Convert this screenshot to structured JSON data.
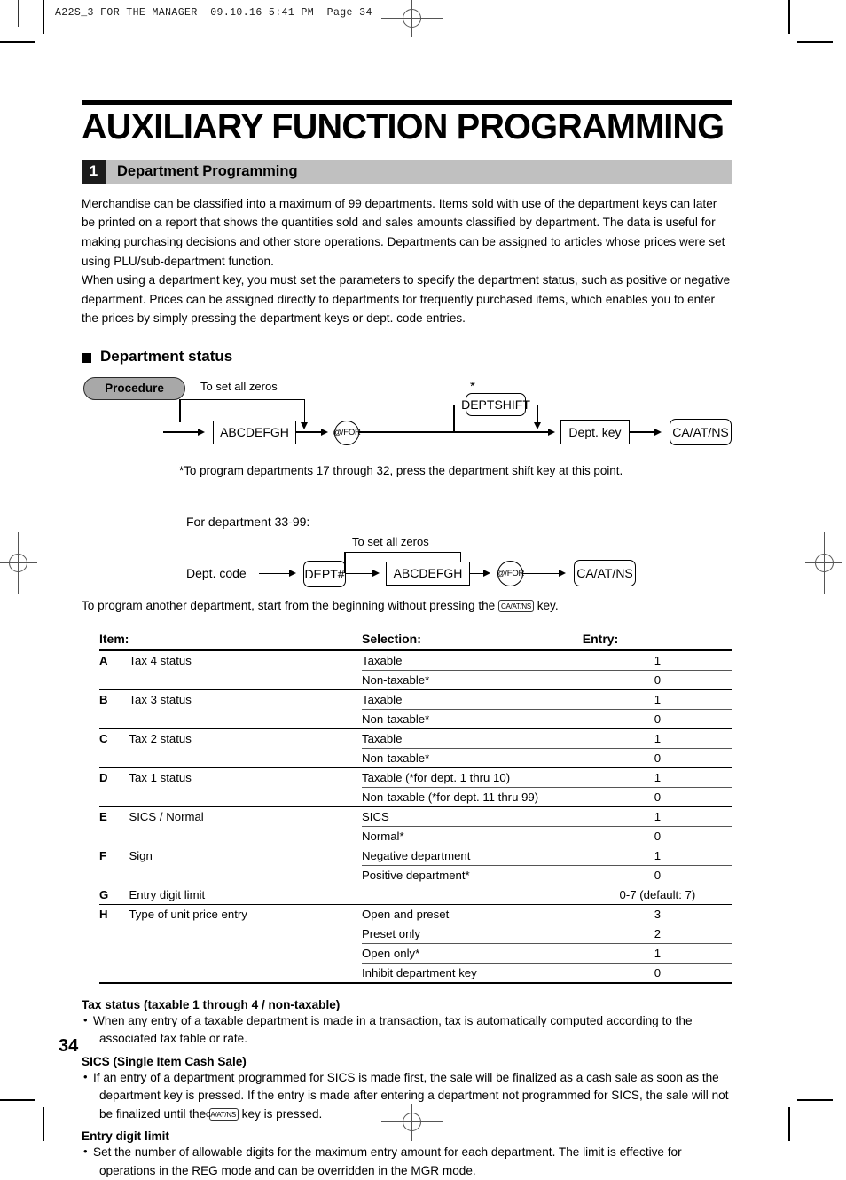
{
  "print_header": "A22S_3 FOR THE MANAGER  09.10.16 5:41 PM  Page 34",
  "page_number": "34",
  "title": "AUXILIARY FUNCTION PROGRAMMING",
  "section": {
    "number": "1",
    "title": "Department Programming"
  },
  "intro": {
    "paragraph1": "Merchandise can be classified into a maximum of 99 departments.  Items sold with use of the department keys can later be printed on a report that shows the quantities sold and sales amounts classified by department.  The data is useful for making purchasing decisions and other store operations.  Departments can be assigned to articles whose prices were set using PLU/sub-department function.",
    "paragraph2": "When using a department key, you must set the parameters to specify the department status, such as positive or negative department.  Prices can be assigned directly to departments for frequently purchased items, which enables you to enter the prices by simply pressing the department keys or dept. code entries."
  },
  "subheading": "Department status",
  "procedure": {
    "badge": "Procedure",
    "set_all_zeros": "To set all zeros",
    "param_box": "ABCDEFGH",
    "for_key": "@/FOR",
    "deptshift_key": "DEPTSHIFT",
    "dept_key": "Dept. key",
    "caatns_key": "CA/AT/NS",
    "star": "*",
    "footnote": "*To program departments 17 through 32, press the department shift key at this point."
  },
  "procedure2": {
    "intro": "For department 33-99:",
    "dept_code_label": "Dept. code",
    "dept_hash_key": "DEPT#",
    "set_all_zeros": "To set all zeros",
    "param_box": "ABCDEFGH",
    "for_key": "@/FOR",
    "caatns_key": "CA/AT/NS"
  },
  "after_procedure_note": {
    "before": "To program another department, start from the beginning without pressing the",
    "key": "CA/AT/NS",
    "after": "key."
  },
  "table": {
    "headers": [
      "Item:",
      "",
      "Selection:",
      "Entry:"
    ],
    "rows": [
      {
        "code": "A",
        "item": "Tax 4 status",
        "options": [
          {
            "selection": "Taxable",
            "entry": "1"
          },
          {
            "selection": "Non-taxable*",
            "entry": "0"
          }
        ]
      },
      {
        "code": "B",
        "item": "Tax 3 status",
        "options": [
          {
            "selection": "Taxable",
            "entry": "1"
          },
          {
            "selection": "Non-taxable*",
            "entry": "0"
          }
        ]
      },
      {
        "code": "C",
        "item": "Tax 2 status",
        "options": [
          {
            "selection": "Taxable",
            "entry": "1"
          },
          {
            "selection": "Non-taxable*",
            "entry": "0"
          }
        ]
      },
      {
        "code": "D",
        "item": "Tax 1 status",
        "options": [
          {
            "selection": "Taxable (*for dept. 1 thru 10)",
            "entry": "1"
          },
          {
            "selection": "Non-taxable (*for dept. 11 thru 99)",
            "entry": "0"
          }
        ]
      },
      {
        "code": "E",
        "item": "SICS / Normal",
        "options": [
          {
            "selection": "SICS",
            "entry": "1"
          },
          {
            "selection": "Normal*",
            "entry": "0"
          }
        ]
      },
      {
        "code": "F",
        "item": "Sign",
        "options": [
          {
            "selection": "Negative department",
            "entry": "1"
          },
          {
            "selection": "Positive department*",
            "entry": "0"
          }
        ]
      },
      {
        "code": "G",
        "item": "Entry digit limit",
        "options": [
          {
            "selection": "",
            "entry": "0-7 (default: 7)"
          }
        ]
      },
      {
        "code": "H",
        "item": "Type of unit price entry",
        "options": [
          {
            "selection": "Open and preset",
            "entry": "3"
          },
          {
            "selection": "Preset only",
            "entry": "2"
          },
          {
            "selection": "Open only*",
            "entry": "1"
          },
          {
            "selection": "Inhibit department key",
            "entry": "0"
          }
        ]
      }
    ]
  },
  "notes": [
    {
      "heading": "Tax status (taxable 1 through 4 / non-taxable)",
      "text": "When any entry of a taxable department is made in a transaction, tax is automatically computed according to the associated tax table or rate."
    },
    {
      "heading": "SICS (Single Item Cash Sale)",
      "text_before": "If an entry of a department programmed for SICS is made first, the sale will be finalized as a cash sale as soon as the department key is pressed.  If the entry is made after entering a department not programmed for SICS, the sale will not be finalized until the",
      "key": "CA/AT/NS",
      "text_after": "key is pressed."
    },
    {
      "heading": "Entry digit limit",
      "text": "Set the number of allowable digits for the maximum entry amount for each department.  The limit is effective for operations in the REG mode and can be overridden in the MGR mode."
    }
  ],
  "bullet_glyph": "•",
  "colors": {
    "section_bar": "#c0c0c0",
    "section_num_bg": "#1c1c1c",
    "procedure_pill": "#a8a8a8",
    "rule": "#000000"
  }
}
